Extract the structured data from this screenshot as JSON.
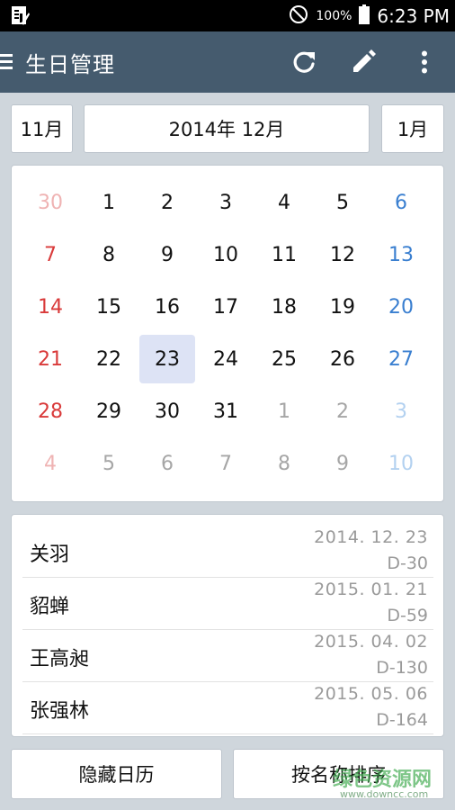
{
  "status_bar": {
    "battery_text": "100%",
    "time": "6:23 PM"
  },
  "app_bar": {
    "title": "生日管理",
    "icons": [
      "menu-icon",
      "refresh-icon",
      "edit-icon",
      "more-vert-icon"
    ]
  },
  "month_nav": {
    "prev": "11月",
    "current": "2014年 12月",
    "next": "1月"
  },
  "calendar": {
    "weeks": [
      [
        {
          "d": "30",
          "m": true
        },
        {
          "d": "1"
        },
        {
          "d": "2"
        },
        {
          "d": "3"
        },
        {
          "d": "4"
        },
        {
          "d": "5"
        },
        {
          "d": "6"
        }
      ],
      [
        {
          "d": "7"
        },
        {
          "d": "8"
        },
        {
          "d": "9"
        },
        {
          "d": "10"
        },
        {
          "d": "11"
        },
        {
          "d": "12"
        },
        {
          "d": "13"
        }
      ],
      [
        {
          "d": "14"
        },
        {
          "d": "15"
        },
        {
          "d": "16"
        },
        {
          "d": "17"
        },
        {
          "d": "18"
        },
        {
          "d": "19"
        },
        {
          "d": "20"
        }
      ],
      [
        {
          "d": "21"
        },
        {
          "d": "22"
        },
        {
          "d": "23",
          "sel": true
        },
        {
          "d": "24"
        },
        {
          "d": "25"
        },
        {
          "d": "26"
        },
        {
          "d": "27"
        }
      ],
      [
        {
          "d": "28"
        },
        {
          "d": "29"
        },
        {
          "d": "30"
        },
        {
          "d": "31"
        },
        {
          "d": "1",
          "m": true
        },
        {
          "d": "2",
          "m": true
        },
        {
          "d": "3",
          "m": true
        }
      ],
      [
        {
          "d": "4",
          "m": true
        },
        {
          "d": "5",
          "m": true
        },
        {
          "d": "6",
          "m": true
        },
        {
          "d": "7",
          "m": true
        },
        {
          "d": "8",
          "m": true
        },
        {
          "d": "9",
          "m": true
        },
        {
          "d": "10",
          "m": true
        }
      ]
    ],
    "colors": {
      "sunday": "#d93a3a",
      "saturday": "#3a7fd0",
      "selected_bg": "#dde3f5"
    }
  },
  "birthdays": [
    {
      "name": "关羽",
      "date": "2014. 12. 23",
      "dday": "D-30"
    },
    {
      "name": "貂蝉",
      "date": "2015. 01. 21",
      "dday": "D-59"
    },
    {
      "name": "王高昶",
      "date": "2015. 04. 02",
      "dday": "D-130"
    },
    {
      "name": "张强林",
      "date": "2015. 05. 06",
      "dday": "D-164"
    }
  ],
  "bottom_buttons": {
    "hide_calendar": "隐藏日历",
    "sort_by_name": "按名称排序"
  },
  "watermark": {
    "text": "绿色资源网",
    "url": "www.downcc.com"
  }
}
